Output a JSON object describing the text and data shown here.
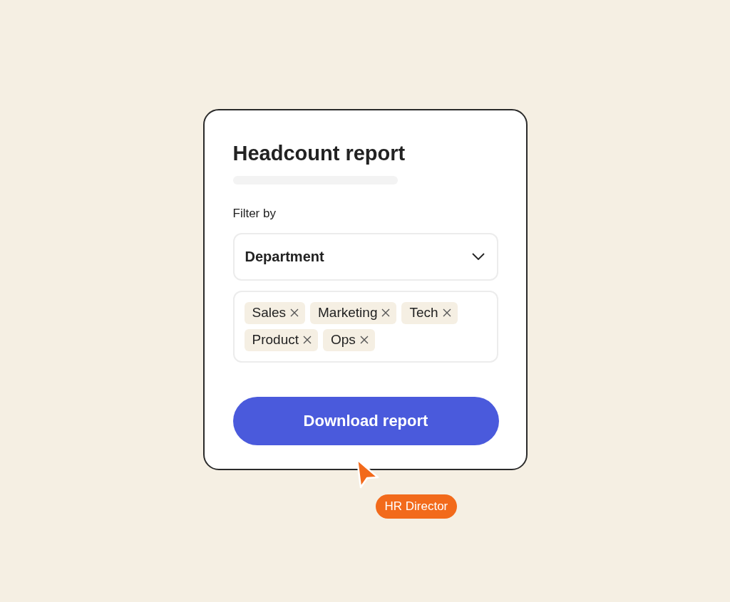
{
  "card": {
    "title": "Headcount report",
    "filter_label": "Filter by",
    "dropdown": {
      "value": "Department"
    },
    "tags": [
      {
        "label": "Sales"
      },
      {
        "label": "Marketing"
      },
      {
        "label": "Tech"
      },
      {
        "label": "Product"
      },
      {
        "label": "Ops"
      }
    ],
    "button": "Download report"
  },
  "cursor": {
    "label": "HR Director"
  }
}
